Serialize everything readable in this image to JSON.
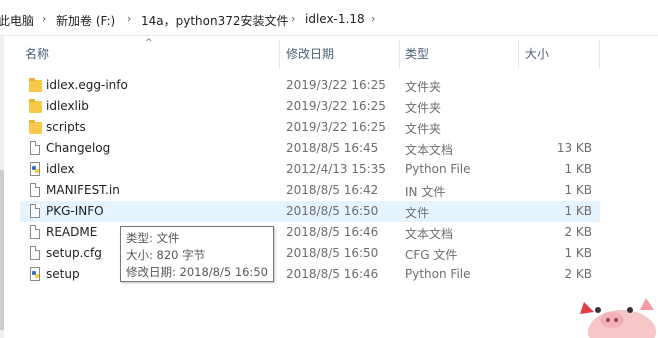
{
  "breadcrumb": {
    "items": [
      "此电脑",
      "新加卷 (F:)",
      "14a，python372安装文件",
      "idlex-1.18"
    ]
  },
  "columns": {
    "name": "名称",
    "date": "修改日期",
    "type": "类型",
    "size": "大小"
  },
  "files": [
    {
      "name": "idlex.egg-info",
      "date": "2019/3/22 16:25",
      "type": "文件夹",
      "size": "",
      "icon": "folder-icon"
    },
    {
      "name": "idlexlib",
      "date": "2019/3/22 16:25",
      "type": "文件夹",
      "size": "",
      "icon": "folder-icon"
    },
    {
      "name": "scripts",
      "date": "2019/3/22 16:25",
      "type": "文件夹",
      "size": "",
      "icon": "folder-icon"
    },
    {
      "name": "Changelog",
      "date": "2018/8/5 16:45",
      "type": "文本文档",
      "size": "13 KB",
      "icon": "text-file-icon"
    },
    {
      "name": "idlex",
      "date": "2012/4/13 15:35",
      "type": "Python File",
      "size": "1 KB",
      "icon": "python-file-icon"
    },
    {
      "name": "MANIFEST.in",
      "date": "2018/8/5 16:42",
      "type": "IN 文件",
      "size": "1 KB",
      "icon": "file-icon"
    },
    {
      "name": "PKG-INFO",
      "date": "2018/8/5 16:50",
      "type": "文件",
      "size": "1 KB",
      "icon": "file-icon"
    },
    {
      "name": "README",
      "date": "2018/8/5 16:46",
      "type": "文本文档",
      "size": "2 KB",
      "icon": "text-file-icon"
    },
    {
      "name": "setup.cfg",
      "date": "2018/8/5 16:50",
      "type": "CFG 文件",
      "size": "1 KB",
      "icon": "file-icon"
    },
    {
      "name": "setup",
      "date": "2018/8/5 16:46",
      "type": "Python File",
      "size": "2 KB",
      "icon": "python-file-icon"
    }
  ],
  "tooltip": {
    "line1": "类型: 文件",
    "line2": "大小: 820 字节",
    "line3": "修改日期: 2018/8/5 16:50"
  },
  "colors": {
    "hover_row": "#e5f3ff",
    "header_text": "#4c607a",
    "folder": "#f6c94b"
  }
}
